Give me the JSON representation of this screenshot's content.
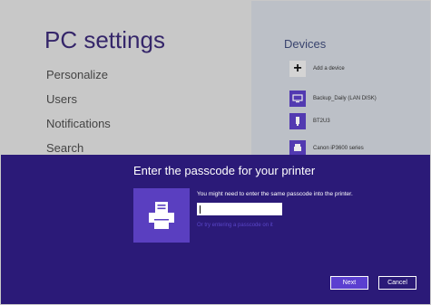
{
  "settings": {
    "title": "PC settings",
    "nav": [
      "Personalize",
      "Users",
      "Notifications",
      "Search"
    ]
  },
  "devices": {
    "heading": "Devices",
    "add_label": "Add a device",
    "items": [
      {
        "label": "Backup_Daily (LAN DISK)",
        "icon": "monitor-icon"
      },
      {
        "label": "BT2U3",
        "icon": "usb-device-icon"
      },
      {
        "label": "Canon iP3600 series",
        "icon": "printer-icon"
      }
    ]
  },
  "dialog": {
    "title": "Enter the passcode for your printer",
    "message": "You might need to enter the same passcode into the printer.",
    "passcode_value": "",
    "try_link": "Or try entering a passcode on it",
    "next_label": "Next",
    "cancel_label": "Cancel"
  },
  "colors": {
    "dialog_bg": "#2b1a78",
    "accent": "#5a3fc0",
    "button_primary": "#5b3fd0"
  }
}
